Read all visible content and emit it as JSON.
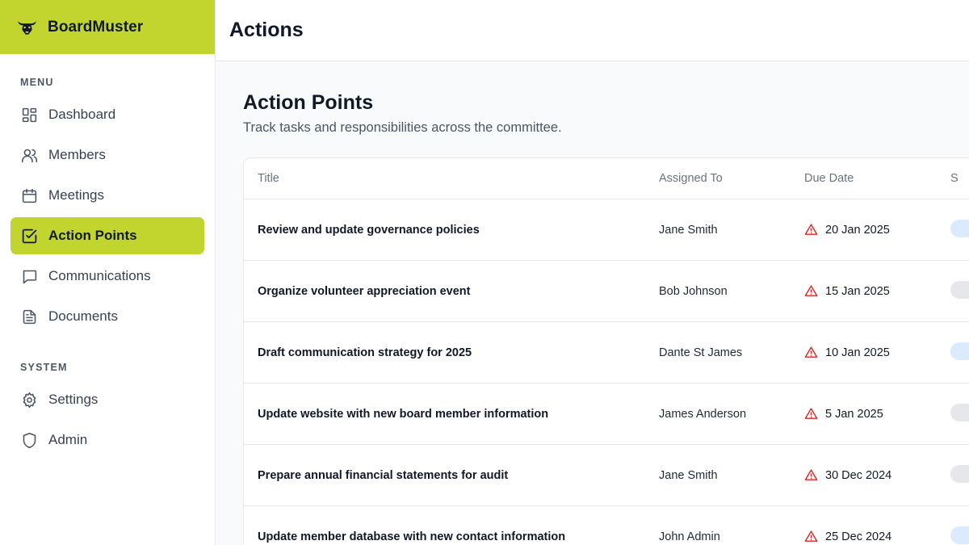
{
  "app": {
    "name": "BoardMuster",
    "brand_color": "#c2d52f"
  },
  "sidebar": {
    "menu_label": "MENU",
    "menu_items": [
      {
        "label": "Dashboard",
        "icon": "dashboard-icon"
      },
      {
        "label": "Members",
        "icon": "users-icon"
      },
      {
        "label": "Meetings",
        "icon": "calendar-icon"
      },
      {
        "label": "Action Points",
        "icon": "checkbox-icon",
        "active": true
      },
      {
        "label": "Communications",
        "icon": "message-icon"
      },
      {
        "label": "Documents",
        "icon": "document-icon"
      }
    ],
    "system_label": "SYSTEM",
    "system_items": [
      {
        "label": "Settings",
        "icon": "gear-icon"
      },
      {
        "label": "Admin",
        "icon": "shield-icon"
      }
    ]
  },
  "header": {
    "title": "Actions"
  },
  "main": {
    "heading": "Action Points",
    "subheading": "Track tasks and responsibilities across the committee.",
    "table": {
      "columns": [
        "Title",
        "Assigned To",
        "Due Date",
        "S"
      ],
      "rows": [
        {
          "title": "Review and update governance policies",
          "assigned": "Jane Smith",
          "due": "20 Jan 2025",
          "status_color": "blue"
        },
        {
          "title": "Organize volunteer appreciation event",
          "assigned": "Bob Johnson",
          "due": "15 Jan 2025",
          "status_color": "gray"
        },
        {
          "title": "Draft communication strategy for 2025",
          "assigned": "Dante St James",
          "due": "10 Jan 2025",
          "status_color": "blue"
        },
        {
          "title": "Update website with new board member information",
          "assigned": "James Anderson",
          "due": "5 Jan 2025",
          "status_color": "gray"
        },
        {
          "title": "Prepare annual financial statements for audit",
          "assigned": "Jane Smith",
          "due": "30 Dec 2024",
          "status_color": "gray"
        },
        {
          "title": "Update member database with new contact information",
          "assigned": "John Admin",
          "due": "25 Dec 2024",
          "status_color": "blue"
        }
      ]
    }
  },
  "colors": {
    "overdue": "#dc2626",
    "accent": "#c2d52f"
  }
}
